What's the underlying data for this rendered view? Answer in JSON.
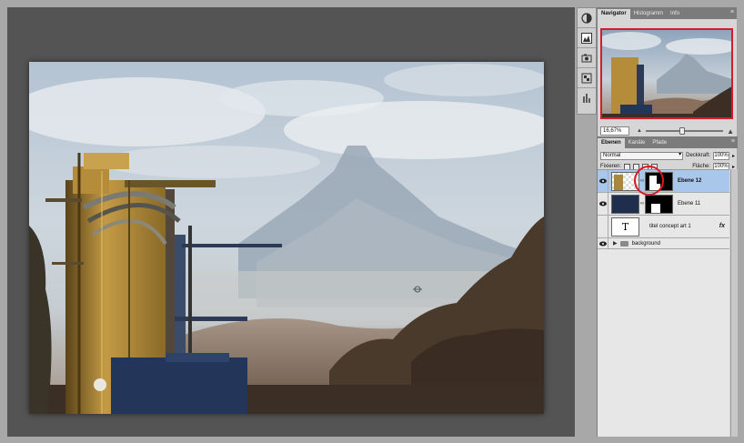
{
  "colors": {
    "workspace_bg": "#545454",
    "panel_bg": "#d6d6d6",
    "tab_bar": "#7b7b7b",
    "selection": "#a9c7ea",
    "navigator_frame": "#d51d2a",
    "annotation_circle": "#e0161f"
  },
  "dock": {
    "tools": [
      {
        "icon": "navigator-icon"
      },
      {
        "icon": "histogram-icon"
      },
      {
        "icon": "info-icon"
      },
      {
        "icon": "layers-icon"
      },
      {
        "icon": "channels-icon"
      }
    ]
  },
  "navigator_panel": {
    "tabs": [
      {
        "label": "Navigator",
        "active": true
      },
      {
        "label": "Histogramm",
        "active": false
      },
      {
        "label": "Info",
        "active": false
      }
    ],
    "zoom_value": "16,67%"
  },
  "layers_panel": {
    "tabs": [
      {
        "label": "Ebenen",
        "active": true
      },
      {
        "label": "Kanäle",
        "active": false
      },
      {
        "label": "Pfade",
        "active": false
      }
    ],
    "blend_mode": "Normal",
    "opacity_label": "Deckkraft:",
    "opacity_value": "100%",
    "lock_label": "Fixieren:",
    "fill_label": "Fläche:",
    "fill_value": "100%",
    "layers": [
      {
        "name": "Ebene 12",
        "selected": true,
        "visible": true,
        "kind": "masked"
      },
      {
        "name": "Ebene 11",
        "selected": false,
        "visible": true,
        "kind": "masked"
      },
      {
        "name": "titel concept art 1",
        "selected": false,
        "visible": false,
        "kind": "type",
        "type_glyph": "T",
        "fx": "fx"
      },
      {
        "name": "background",
        "selected": false,
        "visible": true,
        "kind": "group"
      }
    ]
  }
}
